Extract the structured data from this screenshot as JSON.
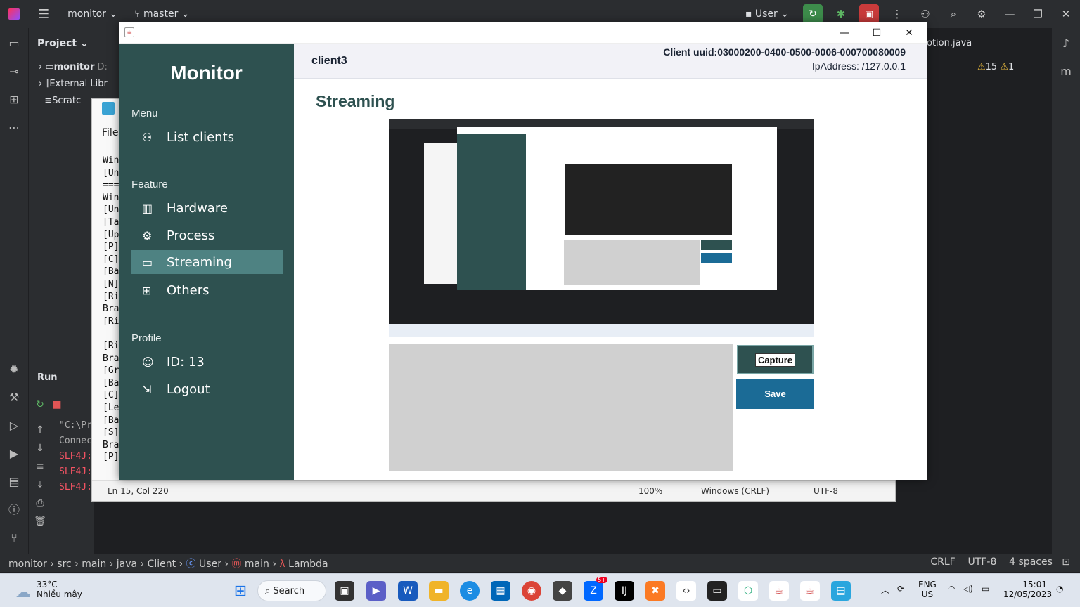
{
  "ide": {
    "project": "monitor",
    "branch": "master",
    "user": "User",
    "project_pane_title": "Project",
    "tree": [
      "monitor",
      "External Libr",
      "Scratc"
    ],
    "tree_hint": "D:",
    "editor_tab": "otion.java",
    "warnings": "15",
    "weak_warnings": "1",
    "run_label": "Run",
    "console": [
      "\"C:\\Pr",
      "Connec",
      "SLF4J:",
      "SLF4J:",
      "SLF4J:"
    ],
    "breadcrumb": [
      "monitor",
      "src",
      "main",
      "java",
      "Client",
      "User",
      "main",
      "Lambda"
    ],
    "status": {
      "line_sep": "CRLF",
      "encoding": "UTF-8",
      "indent": "4 spaces"
    }
  },
  "notepad": {
    "menu": "File",
    "lines": [
      "Win",
      "[Un",
      "===",
      "Win",
      "[Un",
      "[Ta",
      "[Up",
      "[P]",
      "[C]",
      "[Ba",
      "[N]",
      "[Ri",
      "Bra",
      "[Ri",
      "",
      "[Ri",
      "Bra",
      "[Gr",
      "[Ba",
      "[C]",
      "[Le",
      "[Ba",
      "[S]",
      "Bra",
      "[P]"
    ],
    "status": {
      "pos": "Ln 15, Col 220",
      "zoom": "100%",
      "eol": "Windows (CRLF)",
      "enc": "UTF-8"
    }
  },
  "monitor": {
    "brand": "Monitor",
    "sections": {
      "menu": "Menu",
      "feature": "Feature",
      "profile": "Profile"
    },
    "nav": {
      "list_clients": "List clients",
      "hardware": "Hardware",
      "process": "Process",
      "streaming": "Streaming",
      "others": "Others",
      "id": "ID: 13",
      "logout": "Logout"
    },
    "client_name": "client3",
    "client_uuid": "Client uuid:03000200-0400-0500-0006-000700080009",
    "ip": "IpAddress: /127.0.0.1",
    "page_title": "Streaming",
    "capture_label": "Capture",
    "save_label": "Save"
  },
  "taskbar": {
    "temp": "33°C",
    "weather": "Nhiều mây",
    "search": "Search",
    "lang1": "ENG",
    "lang2": "US",
    "time": "15:01",
    "date": "12/05/2023",
    "zalo_badge": "5+"
  }
}
